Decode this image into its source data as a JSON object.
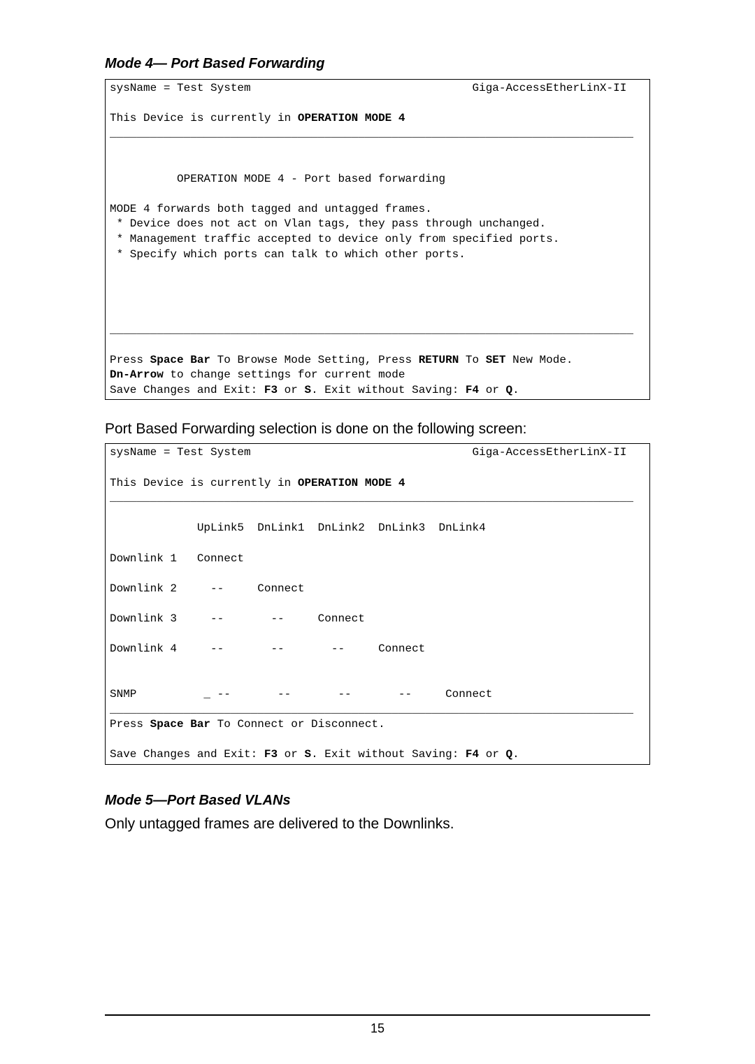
{
  "heading_mode4": "Mode 4— Port Based Forwarding",
  "terminal1": {
    "sysname": "sysName = Test System",
    "device": "Giga-AccessEtherLinX-II",
    "line_current_a": "This Device is currently in ",
    "line_current_b": "OPERATION MODE 4",
    "sep": "______________________________________________________________________________",
    "title": "          OPERATION MODE 4 - Port based forwarding",
    "body1": "MODE 4 forwards both tagged and untagged frames.",
    "body2": " * Device does not act on Vlan tags, they pass through unchanged.",
    "body3": " * Management traffic accepted to device only from specified ports.",
    "body4": " * Specify which ports can talk to which other ports.",
    "instr1a": "Press ",
    "instr1b": "Space Bar",
    "instr1c": " To Browse Mode Setting, Press ",
    "instr1d": "RETURN",
    "instr1e": " To ",
    "instr1f": "SET",
    "instr1g": " New Mode.",
    "instr2a": "Dn-Arrow",
    "instr2b": " to change settings for current mode",
    "instr3a": "Save Changes and Exit: ",
    "instr3b": "F3",
    "instr3c": " or ",
    "instr3d": "S",
    "instr3e": ". Exit without Saving: ",
    "instr3f": "F4",
    "instr3g": " or ",
    "instr3h": "Q",
    "instr3i": "."
  },
  "midprose": "Port Based Forwarding selection is done on the following screen:",
  "terminal2": {
    "sysname": "sysName = Test System",
    "device": "Giga-AccessEtherLinX-II",
    "line_current_a": "This Device is currently in ",
    "line_current_b": "OPERATION MODE 4",
    "sep": "______________________________________________________________________________",
    "header": "             UpLink5  DnLink1  DnLink2  DnLink3  DnLink4",
    "r1": "Downlink 1   Connect",
    "r2": "Downlink 2     --     Connect",
    "r3": "Downlink 3     --       --     Connect",
    "r4": "Downlink 4     --       --       --     Connect",
    "snmp": "SNMP          _ --       --       --       --     Connect",
    "instrA1": "Press ",
    "instrA2": "Space Bar",
    "instrA3": " To Connect or Disconnect.",
    "instrB1": "Save Changes and Exit: ",
    "instrB2": "F3",
    "instrB3": " or ",
    "instrB4": "S",
    "instrB5": ". Exit without Saving: ",
    "instrB6": "F4",
    "instrB7": " or ",
    "instrB8": "Q",
    "instrB9": "."
  },
  "heading_mode5": "Mode 5—Port Based VLANs",
  "prose_mode5": "Only untagged frames are delivered to the Downlinks.",
  "page_number": "15"
}
